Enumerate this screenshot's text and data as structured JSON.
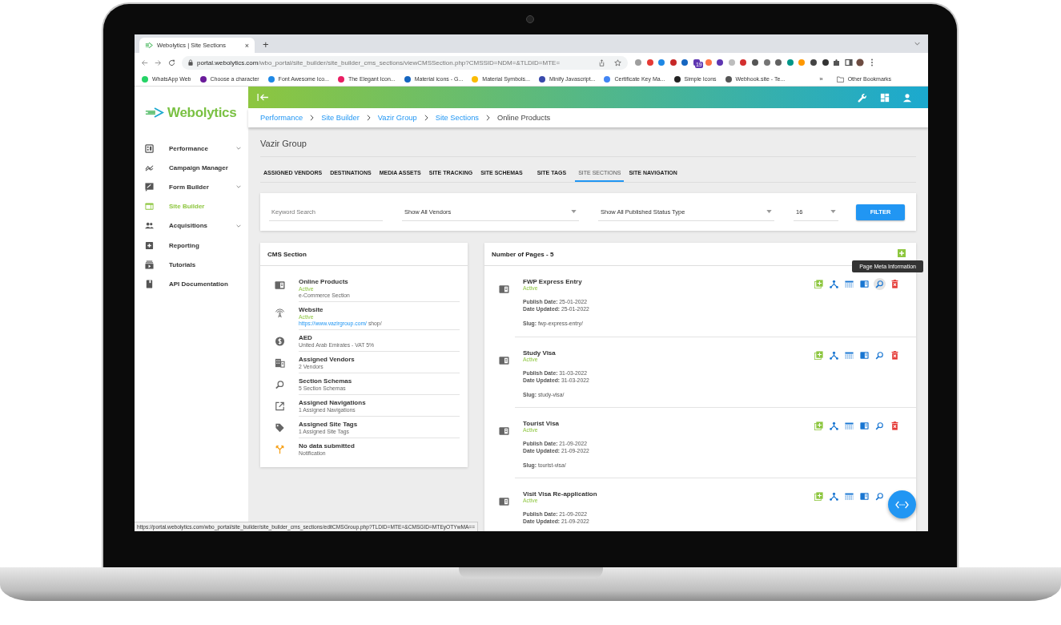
{
  "browser": {
    "tab_title": "Webolytics | Site Sections",
    "tab_close": "×",
    "new_tab": "+",
    "url_domain": "portal.webolytics.com",
    "url_path": "/wbo_portal/site_builder/site_builder_cms_sections/viewCMSSection.php?CMSSID=NDM=&TLDID=MTE=",
    "extension_badge": "19",
    "bookmarks": [
      {
        "label": "WhatsApp Web",
        "color": "#25d366"
      },
      {
        "label": "Choose a character",
        "color": "#6a1b9a"
      },
      {
        "label": "Font Awesome Ico...",
        "color": "#1e88e5"
      },
      {
        "label": "The Elegant Icon...",
        "color": "#e91e63"
      },
      {
        "label": "Material icons - G...",
        "color": "#1565c0"
      },
      {
        "label": "Material Symbols...",
        "color": "#fbbc04"
      },
      {
        "label": "Minify Javascript...",
        "color": "#3949ab"
      },
      {
        "label": "Certificate Key Ma...",
        "color": "#4285f4"
      },
      {
        "label": "Simple Icons",
        "color": "#222222"
      },
      {
        "label": "Webhook.site - Te...",
        "color": "#555555"
      }
    ],
    "more_bookmarks": "»",
    "other_bookmarks": "Other Bookmarks",
    "status_url": "https://portal.webolytics.com/wbo_portal/site_builder/site_builder_cms_sections/editCMSGroup.php?TLDID=MTE=&CMSGID=MTEyOTYwMA=="
  },
  "app": {
    "logo": "Webolytics",
    "sidebar": [
      {
        "label": "Performance",
        "expandable": true,
        "selected": false
      },
      {
        "label": "Campaign Manager",
        "expandable": false,
        "selected": false
      },
      {
        "label": "Form Builder",
        "expandable": true,
        "selected": false
      },
      {
        "label": "Site Builder",
        "expandable": false,
        "selected": true
      },
      {
        "label": "Acquisitions",
        "expandable": true,
        "selected": false
      },
      {
        "label": "Reporting",
        "expandable": false,
        "selected": false
      },
      {
        "label": "Tutorials",
        "expandable": false,
        "selected": false
      },
      {
        "label": "API Documentation",
        "expandable": false,
        "selected": false
      }
    ],
    "breadcrumb": [
      {
        "label": "Performance",
        "link": true
      },
      {
        "label": "Site Builder",
        "link": true
      },
      {
        "label": "Vazir Group",
        "link": true
      },
      {
        "label": "Site Sections",
        "link": true
      },
      {
        "label": "Online Products",
        "link": false
      }
    ],
    "title": "Vazir Group",
    "tabs": [
      {
        "label": "ASSIGNED VENDORS",
        "selected": false
      },
      {
        "label": "DESTINATIONS",
        "selected": false
      },
      {
        "label": "MEDIA ASSETS",
        "selected": false
      },
      {
        "label": "SITE TRACKING",
        "selected": false
      },
      {
        "label": "SITE SCHEMAS",
        "selected": false
      },
      {
        "label": "SITE TAGS",
        "selected": false
      },
      {
        "label": "SITE SECTIONS",
        "selected": true
      },
      {
        "label": "SITE NAVIGATION",
        "selected": false
      }
    ],
    "filters": {
      "keyword_placeholder": "Keyword Search",
      "vendor": "Show All Vendors",
      "status": "Show All Published Status Type",
      "count": "16",
      "button": "FILTER"
    },
    "cms_panel": {
      "title": "CMS Section",
      "items": [
        {
          "title": "Online Products",
          "status": "Active",
          "detail": "e-Commerce Section"
        },
        {
          "title": "Website",
          "status": "Active",
          "link": "https://www.vazirgroup.com/",
          "detail": "shop/"
        },
        {
          "title": "AED",
          "detail": "United Arab Emirates - VAT 5%"
        },
        {
          "title": "Assigned Vendors",
          "detail": "2 Vendors"
        },
        {
          "title": "Section Schemas",
          "detail": "5 Section Schemas"
        },
        {
          "title": "Assigned Navigations",
          "detail": "1 Assigned Navigations"
        },
        {
          "title": "Assigned Site Tags",
          "detail": "1 Assigned Site Tags"
        },
        {
          "title": "No data submitted",
          "detail": "Notification"
        }
      ]
    },
    "pages_panel": {
      "title": "Number of Pages - 5",
      "tooltip": "Page Meta Information",
      "pages": [
        {
          "title": "FWP Express Entry",
          "status": "Active",
          "fields": [
            {
              "kind": "date",
              "label": "Publish Date:",
              "value": "25-01-2022"
            },
            {
              "kind": "date",
              "label": "Date Updated:",
              "value": "25-01-2022"
            },
            {
              "kind": "slug",
              "label": "Slug:",
              "value": "fwp-express-entry/"
            }
          ],
          "actions": [
            {
              "kind": "add",
              "hovered": false
            },
            {
              "kind": "tree",
              "hovered": false
            },
            {
              "kind": "table",
              "hovered": false
            },
            {
              "kind": "panel",
              "hovered": false
            },
            {
              "kind": "search",
              "hovered": true
            },
            {
              "kind": "delete",
              "hovered": false
            }
          ]
        },
        {
          "title": "Study Visa",
          "status": "Active",
          "fields": [
            {
              "kind": "date",
              "label": "Publish Date:",
              "value": "31-03-2022"
            },
            {
              "kind": "date",
              "label": "Date Updated:",
              "value": "31-03-2022"
            },
            {
              "kind": "slug",
              "label": "Slug:",
              "value": "study-visa/"
            }
          ],
          "actions": [
            {
              "kind": "add",
              "hovered": false
            },
            {
              "kind": "tree",
              "hovered": false
            },
            {
              "kind": "table",
              "hovered": false
            },
            {
              "kind": "panel",
              "hovered": false
            },
            {
              "kind": "search",
              "hovered": false
            },
            {
              "kind": "delete",
              "hovered": false
            }
          ]
        },
        {
          "title": "Tourist Visa",
          "status": "Active",
          "fields": [
            {
              "kind": "date",
              "label": "Publish Date:",
              "value": "21-09-2022"
            },
            {
              "kind": "date",
              "label": "Date Updated:",
              "value": "21-09-2022"
            },
            {
              "kind": "slug",
              "label": "Slug:",
              "value": "tourist-visa/"
            }
          ],
          "actions": [
            {
              "kind": "add",
              "hovered": false
            },
            {
              "kind": "tree",
              "hovered": false
            },
            {
              "kind": "table",
              "hovered": false
            },
            {
              "kind": "panel",
              "hovered": false
            },
            {
              "kind": "search",
              "hovered": false
            },
            {
              "kind": "delete",
              "hovered": false
            }
          ]
        },
        {
          "title": "Visit Visa Re-application",
          "status": "Active",
          "fields": [
            {
              "kind": "date",
              "label": "Publish Date:",
              "value": "21-09-2022"
            },
            {
              "kind": "date",
              "label": "Date Updated:",
              "value": "21-09-2022"
            }
          ],
          "actions": [
            {
              "kind": "add",
              "hovered": false
            },
            {
              "kind": "tree",
              "hovered": false
            },
            {
              "kind": "table",
              "hovered": false
            },
            {
              "kind": "panel",
              "hovered": false
            },
            {
              "kind": "search",
              "hovered": false
            }
          ]
        }
      ]
    }
  }
}
